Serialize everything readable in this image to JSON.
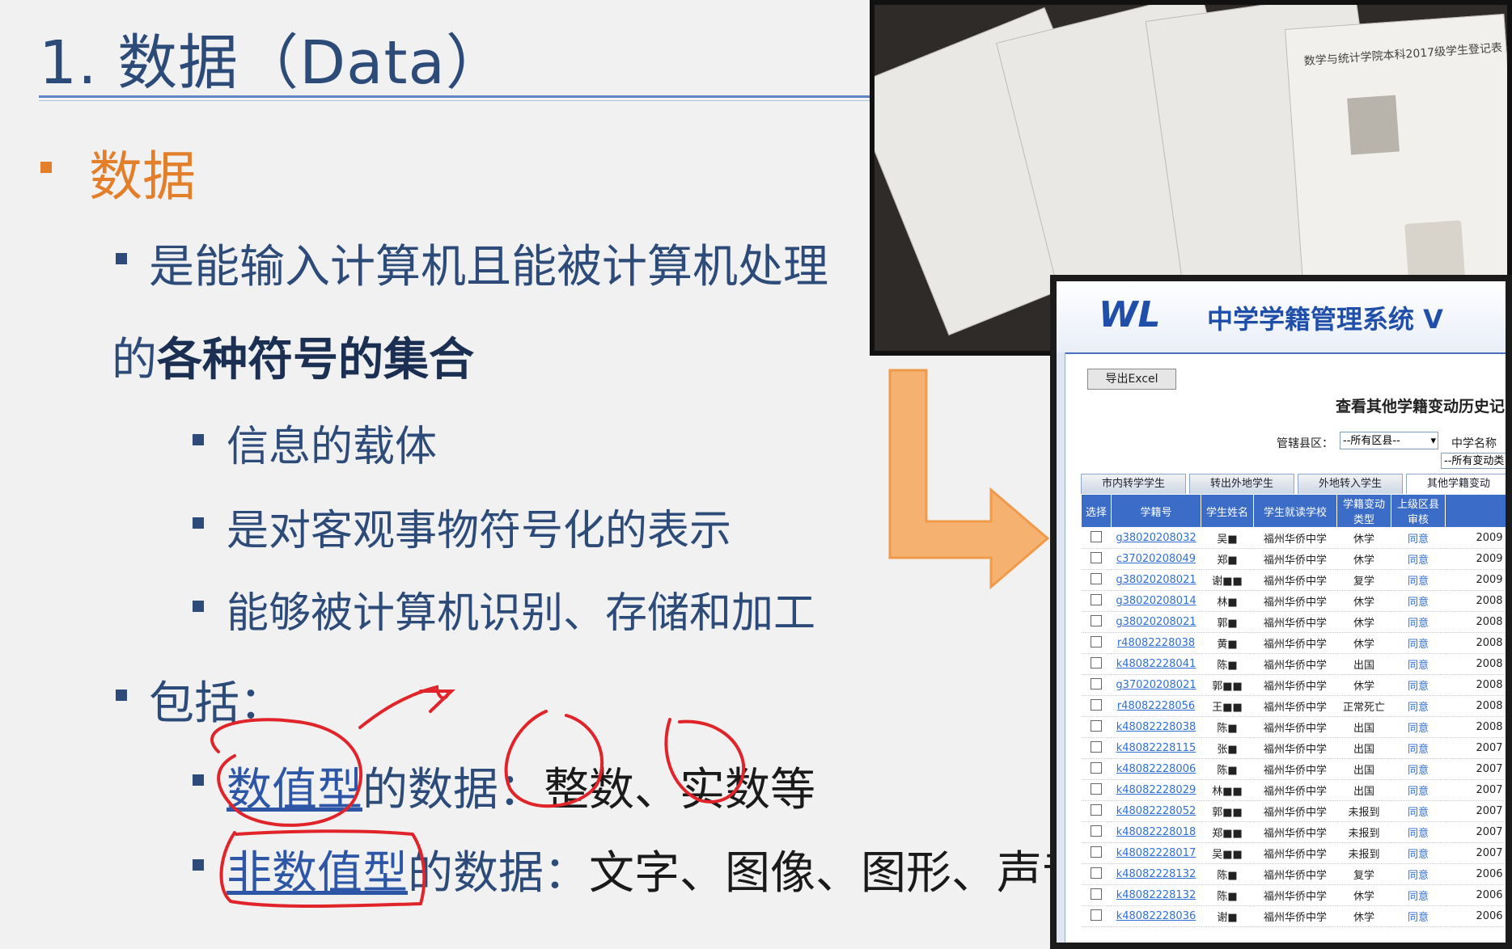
{
  "slide": {
    "title": "1. 数据（Data）",
    "level1": "数据",
    "definition_line1": "是能输入计算机且能被计算机处理",
    "definition_line2_prefix": "的",
    "definition_line2_bold": "各种符号的集合",
    "sub_points": [
      "信息的载体",
      "是对客观事物符号化的表示",
      "能够被计算机识别、存储和加工"
    ],
    "includes_label": "包括：",
    "numeric_type": "数值型",
    "numeric_rest": "的数据：",
    "numeric_examples": "整数、实数等",
    "nonnumeric_type": "非数值型",
    "nonnumeric_rest": "的数据：",
    "nonnumeric_examples": "文字、图像、图形、声音等"
  },
  "photo": {
    "paper_caption": "数学与统计学院本科2017级学生登记表"
  },
  "ui": {
    "logo": "WL",
    "system_title": "中学学籍管理系统 V",
    "export_button": "导出Excel",
    "page_heading": "查看其他学籍变动历史记",
    "district_label": "管辖县区：",
    "district_value": "--所有区县--",
    "school_label": "中学名称",
    "change_value": "--所有变动类",
    "tabs": [
      "市内转学学生",
      "转出外地学生",
      "外地转入学生",
      "其他学籍变动"
    ],
    "columns": [
      "选择",
      "学籍号",
      "学生姓名",
      "学生就读学校",
      "学籍变动类型",
      "上级区县审核",
      ""
    ],
    "rows": [
      {
        "id": "g38020208032",
        "name": "吴■",
        "school": "福州华侨中学",
        "type": "休学",
        "review": "同意",
        "date": "2009"
      },
      {
        "id": "c37020208049",
        "name": "郑■",
        "school": "福州华侨中学",
        "type": "休学",
        "review": "同意",
        "date": "2009"
      },
      {
        "id": "g38020208021",
        "name": "谢■■",
        "school": "福州华侨中学",
        "type": "复学",
        "review": "同意",
        "date": "2009"
      },
      {
        "id": "g38020208014",
        "name": "林■",
        "school": "福州华侨中学",
        "type": "休学",
        "review": "同意",
        "date": "2008"
      },
      {
        "id": "g38020208021",
        "name": "郭■",
        "school": "福州华侨中学",
        "type": "休学",
        "review": "同意",
        "date": "2008"
      },
      {
        "id": "r48082228038",
        "name": "黄■",
        "school": "福州华侨中学",
        "type": "休学",
        "review": "同意",
        "date": "2008"
      },
      {
        "id": "k48082228041",
        "name": "陈■",
        "school": "福州华侨中学",
        "type": "出国",
        "review": "同意",
        "date": "2008"
      },
      {
        "id": "g37020208021",
        "name": "郭■■",
        "school": "福州华侨中学",
        "type": "休学",
        "review": "同意",
        "date": "2008"
      },
      {
        "id": "r48082228056",
        "name": "王■■",
        "school": "福州华侨中学",
        "type": "正常死亡",
        "review": "同意",
        "date": "2008"
      },
      {
        "id": "k48082228038",
        "name": "陈■",
        "school": "福州华侨中学",
        "type": "出国",
        "review": "同意",
        "date": "2008"
      },
      {
        "id": "k48082228115",
        "name": "张■",
        "school": "福州华侨中学",
        "type": "出国",
        "review": "同意",
        "date": "2007"
      },
      {
        "id": "k48082228006",
        "name": "陈■",
        "school": "福州华侨中学",
        "type": "出国",
        "review": "同意",
        "date": "2007"
      },
      {
        "id": "k48082228029",
        "name": "林■■",
        "school": "福州华侨中学",
        "type": "出国",
        "review": "同意",
        "date": "2007"
      },
      {
        "id": "k48082228052",
        "name": "郭■■",
        "school": "福州华侨中学",
        "type": "未报到",
        "review": "同意",
        "date": "2007"
      },
      {
        "id": "k48082228018",
        "name": "郑■■",
        "school": "福州华侨中学",
        "type": "未报到",
        "review": "同意",
        "date": "2007"
      },
      {
        "id": "k48082228017",
        "name": "吴■■",
        "school": "福州华侨中学",
        "type": "未报到",
        "review": "同意",
        "date": "2007"
      },
      {
        "id": "k48082228132",
        "name": "陈■",
        "school": "福州华侨中学",
        "type": "复学",
        "review": "同意",
        "date": "2006"
      },
      {
        "id": "k48082228132",
        "name": "陈■",
        "school": "福州华侨中学",
        "type": "休学",
        "review": "同意",
        "date": "2006"
      },
      {
        "id": "k48082228036",
        "name": "谢■",
        "school": "福州华侨中学",
        "type": "休学",
        "review": "同意",
        "date": "2006"
      }
    ]
  },
  "colors": {
    "title_blue": "#2d4b79",
    "accent_orange": "#e37f2a",
    "annotation_red": "#e0242a",
    "table_header": "#3b6cc7"
  },
  "icons": [
    "arrow-icon",
    "dropdown-icon",
    "checkbox-icon"
  ]
}
